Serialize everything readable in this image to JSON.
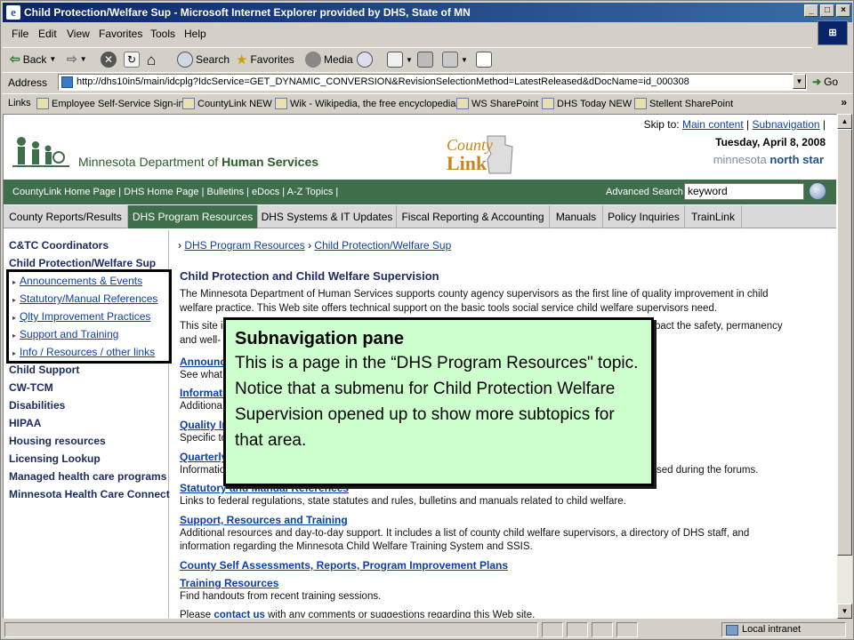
{
  "window": {
    "title": "Child Protection/Welfare Sup - Microsoft Internet Explorer provided by DHS, State of MN",
    "buttons": [
      "_",
      "□",
      "×"
    ]
  },
  "menu": [
    "File",
    "Edit",
    "View",
    "Favorites",
    "Tools",
    "Help"
  ],
  "toolbar": {
    "back": "Back",
    "search": "Search",
    "favorites": "Favorites",
    "media": "Media"
  },
  "address": {
    "label": "Address",
    "url": "http://dhs10in5/main/idcplg?IdcService=GET_DYNAMIC_CONVERSION&RevisionSelectionMethod=LatestReleased&dDocName=id_000308",
    "go": "Go"
  },
  "links_bar": {
    "label": "Links",
    "items": [
      "Employee Self-Service Sign-in",
      "CountyLink NEW",
      "Wik - Wikipedia, the free encyclopedia",
      "WS SharePoint",
      "DHS Today NEW",
      "Stellent SharePoint"
    ]
  },
  "header": {
    "skip_prefix": "Skip to:",
    "skip_main": "Main content",
    "skip_sub": "Subnavigation",
    "date": "Tuesday, April 8, 2008",
    "northstar_a": "minnesota",
    "northstar_b": "north star",
    "org_name_a": "Minnesota Department of",
    "org_name_b": "Human Services",
    "countylink_a": "County",
    "countylink_b": "Link"
  },
  "utility_nav": {
    "links": "CountyLink Home Page | DHS Home Page | Bulletins | eDocs | A-Z Topics |",
    "advanced_search": "Advanced Search",
    "search_value": "keyword"
  },
  "tabs": [
    "County Reports/Results",
    "DHS Program Resources",
    "DHS Systems & IT Updates",
    "Fiscal Reporting & Accounting",
    "Manuals",
    "Policy Inquiries",
    "TrainLink"
  ],
  "left_nav": {
    "top": [
      "C&TC Coordinators",
      "Child Protection/Welfare Sup"
    ],
    "sub": [
      "Announcements & Events",
      "Statutory/Manual References",
      "Qlty Improvement Practices",
      "Support and Training",
      "Info / Resources / other links"
    ],
    "bottom": [
      "Child Support",
      "CW-TCM",
      "Disabilities",
      "HIPAA",
      "Housing resources",
      "Licensing Lookup",
      "Managed health care programs",
      "Minnesota Health Care Connect"
    ]
  },
  "breadcrumb": {
    "first": "DHS Program Resources",
    "second": "Child Protection/Welfare Sup"
  },
  "main": {
    "heading": "Child Protection and Child Welfare Supervision",
    "intro": "The Minnesota Department of Human Services supports county agency supervisors as the first line of quality improvement in child welfare practice. This Web site offers technical support on the basic tools social service child welfare supervisors need.",
    "intro2_a": "This site i",
    "intro2_b": "pact the safety, permanency",
    "intro2_c": "and well-",
    "s1_title": "Announce",
    "s1_desc": "See what",
    "s2_title": "Informatio",
    "s2_desc": "Additiona",
    "s3_title": "Quality Im",
    "s3_desc": "Specific to",
    "s4_title": "Quarterly",
    "s4_desc_a": "Informatio",
    "s4_desc_b": "sed during the forums.",
    "s5_title": "Statutory and Manual References",
    "s5_desc": "Links to federal regulations, state statutes and rules, bulletins and manuals related to child welfare.",
    "s6_title": "Support, Resources and Training",
    "s6_desc": "Additional resources and day-to-day support. It includes a list of county child welfare supervisors, a directory of DHS staff, and information regarding the Minnesota Child Welfare Training System and SSIS.",
    "s7_title": "County Self Assessments, Reports, Program Improvement Plans",
    "s8_title": "Training Resources",
    "s8_desc": "Find handouts from recent training sessions.",
    "contact_a": "Please",
    "contact_link": "contact us",
    "contact_b": "with any comments or suggestions regarding this Web site."
  },
  "callout": {
    "title": "Subnavigation pane",
    "body": "This is a page in the “DHS Program Resources\" topic. Notice that a submenu for Child Protection Welfare Supervision opened up to show more subtopics for that area."
  },
  "status": {
    "zone": "Local intranet"
  }
}
